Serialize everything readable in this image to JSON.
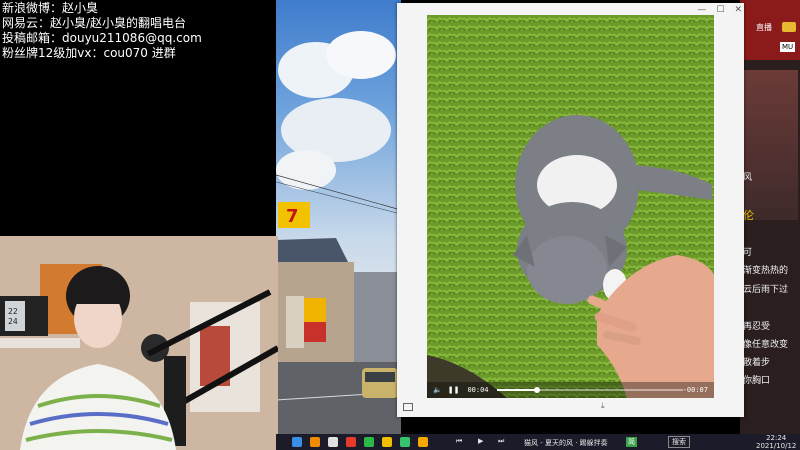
{
  "info_overlay": {
    "lines": [
      "新浪微博：赵小臭",
      "网易云：赵小臭/赵小臭的翻唱电台",
      "投稿邮箱：douyu211086@qq.com",
      "粉丝牌12级加vx：cou070 进群"
    ]
  },
  "streamer_cam": {
    "clock_line1": "22",
    "clock_line2": "24"
  },
  "right_strip": {
    "header_label": "直播",
    "badge_text": "MU",
    "lyrics": [
      "风",
      "伦",
      "可",
      "渐变热热的",
      "云后雨下过",
      "再忍受",
      "像任意改变",
      "散着步",
      "你胸口"
    ]
  },
  "player": {
    "current_time": "00:04",
    "remaining_time": "-00:07",
    "progress": 0.22
  },
  "taskbar": {
    "now_playing": "猫风 - 夏天的风 · 踢躲拌奏",
    "lang_badge": "简",
    "time": "22:24",
    "date": "2021/10/12",
    "tray_label": "搜索"
  },
  "colors": {
    "grass": "#6d9b2b",
    "cat_gray": "#7d7f86",
    "taskbar": "#1b1b2a",
    "player_bg": "#f4f4f4"
  }
}
